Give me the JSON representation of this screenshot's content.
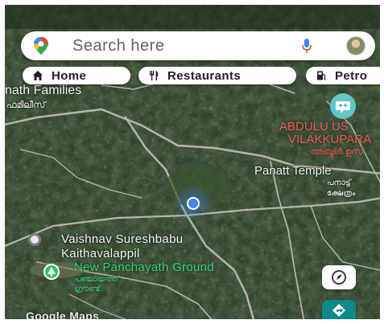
{
  "search": {
    "placeholder": "Search here",
    "icon": "google-maps-pin-icon",
    "mic_icon": "microphone-icon"
  },
  "chips": [
    {
      "label": "Home",
      "icon": "house-icon"
    },
    {
      "label": "Restaurants",
      "icon": "fork-knife-icon"
    },
    {
      "label": "Petro",
      "icon": "fuel-pump-icon"
    }
  ],
  "labels": {
    "nath_families": "nath Families",
    "nath_families_ml": "ഫമിലീസ്",
    "abdul_line1": "ABDULU US",
    "abdul_line2": "VILAKKUPARA",
    "abdul_ml": "അബ്ദുൾ ഉസ്",
    "panatt_temple": "Panatt Temple",
    "panatt_ml1": "പനാട്ട്",
    "panatt_ml2": "ക്ഷേത്രം",
    "vaishnav_line1": "Vaishnav Sureshbabu",
    "vaishnav_line2": "Kaithavalappil",
    "ground": "New Panchayath Ground",
    "ground_ml1": "പഞ്ചായത്ത്",
    "ground_ml2": "ഗ്രൗണ്ട്",
    "google_maps": "Google Maps"
  },
  "colors": {
    "location_dot": "#4285f4",
    "poi_red": "#f05a56",
    "poi_green": "#39d07a",
    "directions": "#0d8a85"
  }
}
